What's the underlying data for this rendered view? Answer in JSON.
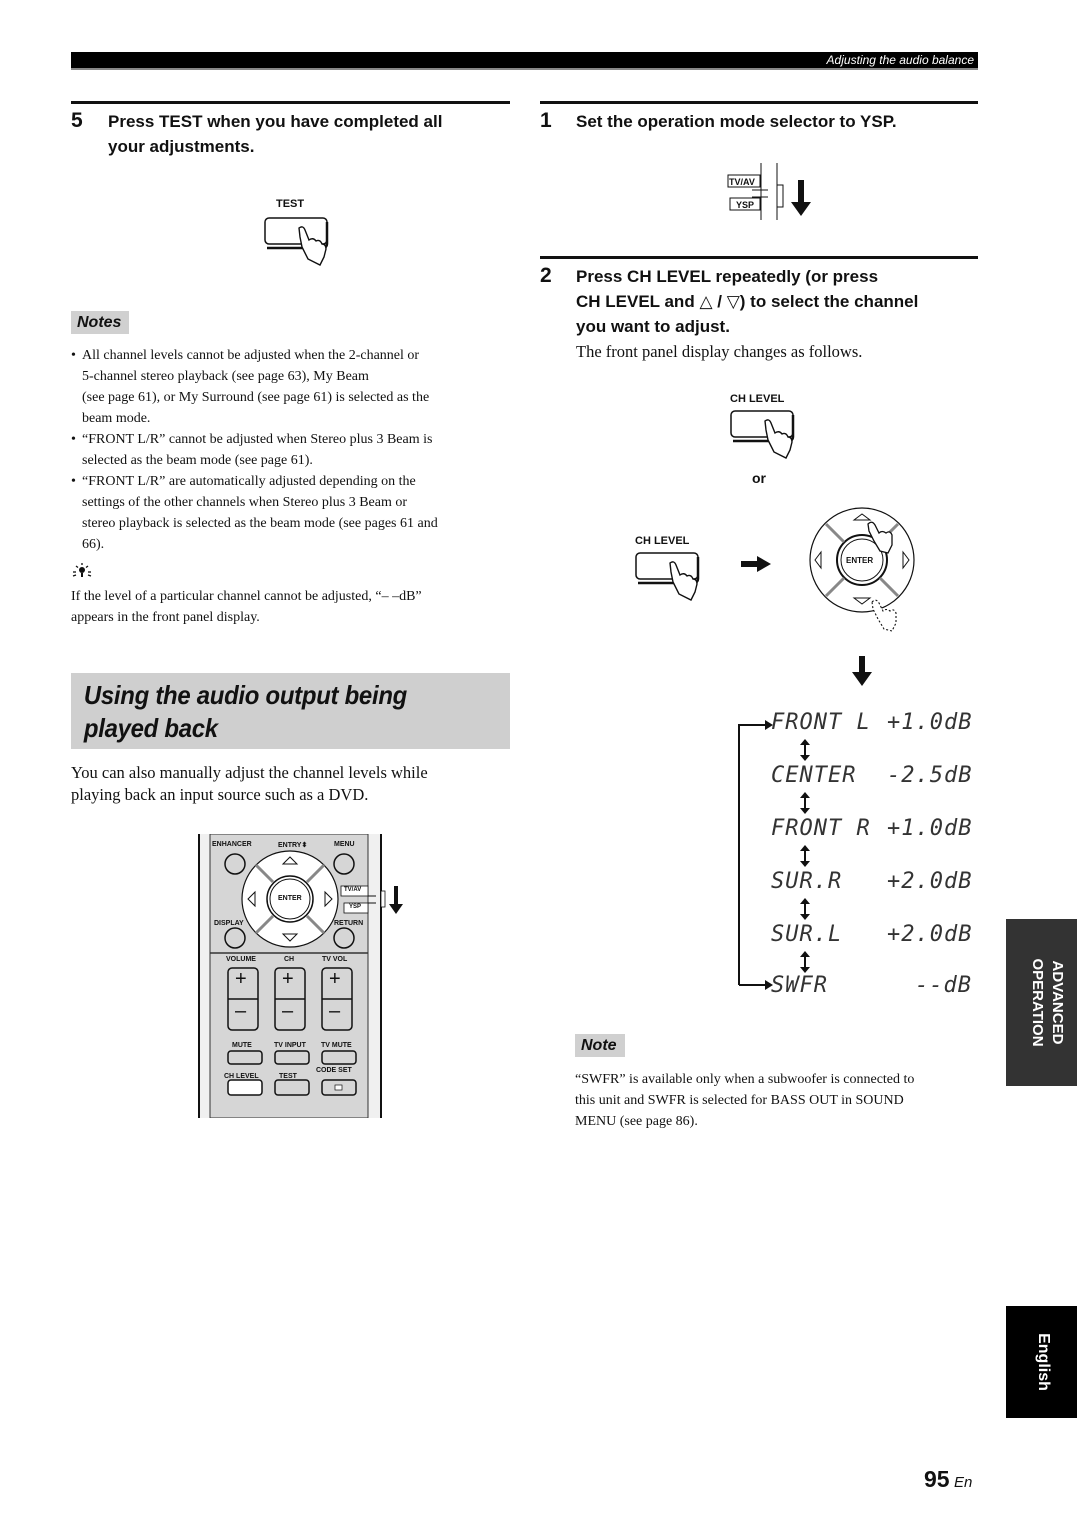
{
  "header": {
    "section": "Adjusting the audio balance"
  },
  "left": {
    "step5": {
      "number": "5",
      "text_line1": "Press TEST when you have completed all",
      "text_line2": "your adjustments.",
      "button_label": "TEST"
    },
    "notes": {
      "label": "Notes",
      "items": [
        {
          "lines": [
            "All channel levels cannot be adjusted when the 2-channel or",
            "5-channel stereo playback (see page 63), My Beam",
            "(see page 61), or My Surround (see page 61) is selected as the",
            "beam mode."
          ]
        },
        {
          "lines": [
            "“FRONT L/R” cannot be adjusted when Stereo plus 3 Beam is",
            "selected as the beam mode (see page 61)."
          ]
        },
        {
          "lines": [
            "“FRONT L/R” are automatically adjusted depending on the",
            "settings of the other channels when Stereo plus 3 Beam or",
            "stereo playback is selected as the beam mode (see pages 61 and",
            "66)."
          ]
        }
      ],
      "bullet": "•"
    },
    "tip": {
      "icon": "lightbulb-icon",
      "lines": [
        "If the level of a particular channel cannot be adjusted, “– –dB”",
        "appears in the front panel display."
      ]
    },
    "section": {
      "title_line1": "Using the audio output being",
      "title_line2": "played back",
      "intro_line1": "You can also manually adjust the channel levels while",
      "intro_line2": "playing back an input source such as a DVD."
    },
    "remote": {
      "top_labels": [
        "ENHANCER",
        "ENTRY⬍",
        "MENU"
      ],
      "enter": "ENTER",
      "display": "DISPLAY",
      "return": "RETURN",
      "selector": [
        "TV/AV",
        "YSP"
      ],
      "rocker_labels": [
        "VOLUME",
        "CH",
        "TV VOL"
      ],
      "plus": "+",
      "minus": "–",
      "row1": [
        "MUTE",
        "TV INPUT",
        "TV MUTE"
      ],
      "code_set": "CODE SET",
      "row2": [
        "CH LEVEL",
        "TEST"
      ]
    }
  },
  "right": {
    "step1": {
      "number": "1",
      "text": "Set the operation mode selector to YSP.",
      "selector": [
        "TV/AV",
        "YSP"
      ]
    },
    "step2": {
      "number": "2",
      "text_line1": "Press CH LEVEL repeatedly (or press",
      "text_line2a": "CH LEVEL and",
      "up_symbol": "△",
      "slash": "/",
      "down_symbol": "▽",
      "text_line2b": ") to select the channel",
      "text_line3": "you want to adjust.",
      "description": "The front panel display changes as follows.",
      "button_label": "CH LEVEL",
      "or": "or",
      "enter": "ENTER"
    },
    "display_sequence": [
      {
        "channel": "FRONT L",
        "level": "+1.0dB"
      },
      {
        "channel": "CENTER",
        "level": "-2.5dB"
      },
      {
        "channel": "FRONT R",
        "level": "+1.0dB"
      },
      {
        "channel": "SUR.R",
        "level": "+2.0dB"
      },
      {
        "channel": "SUR.L",
        "level": "+2.0dB"
      },
      {
        "channel": "SWFR",
        "level": "--dB"
      }
    ],
    "note": {
      "label": "Note",
      "lines": [
        "“SWFR” is available only when a subwoofer is connected to",
        "this unit and SWFR is selected for BASS OUT in SOUND",
        "MENU (see page 86)."
      ]
    }
  },
  "side_tabs": {
    "advanced_line1": "ADVANCED",
    "advanced_line2": "OPERATION",
    "language": "English"
  },
  "footer": {
    "page_number": "95",
    "page_suffix": "En"
  }
}
